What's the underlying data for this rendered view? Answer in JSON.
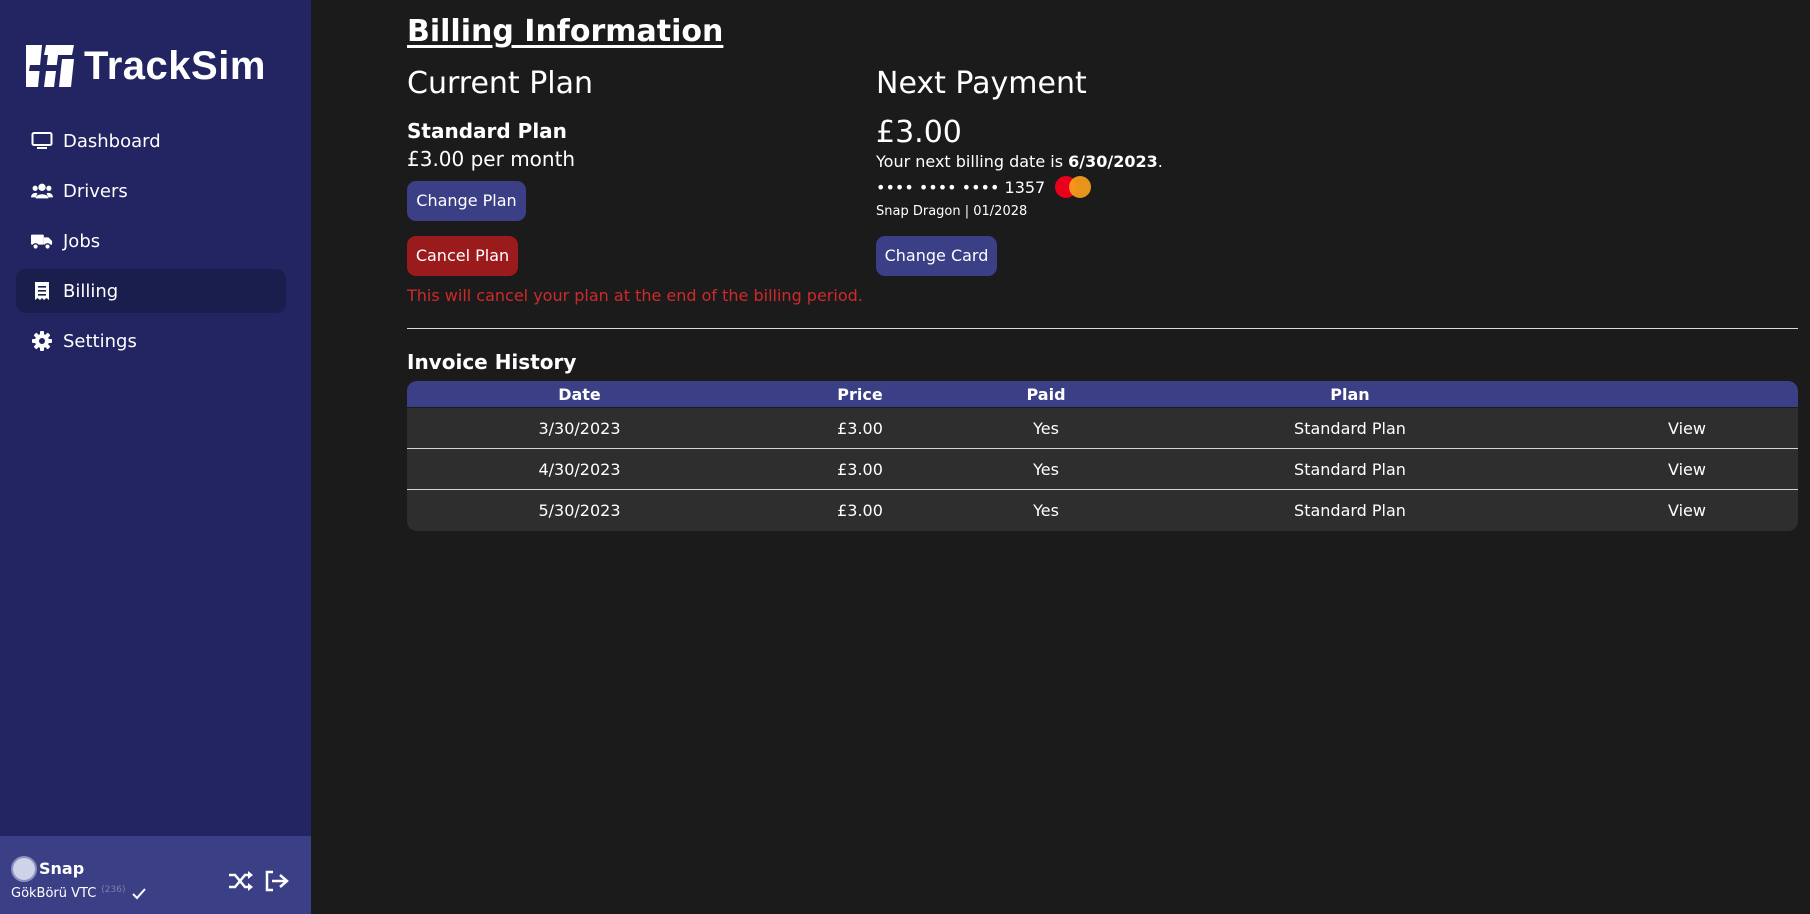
{
  "app": {
    "logo_text": "TrackSim"
  },
  "sidebar": {
    "items": [
      {
        "label": "Dashboard",
        "icon": "monitor-icon"
      },
      {
        "label": "Drivers",
        "icon": "users-icon"
      },
      {
        "label": "Jobs",
        "icon": "truck-icon"
      },
      {
        "label": "Billing",
        "icon": "receipt-icon",
        "active": true
      },
      {
        "label": "Settings",
        "icon": "gear-icon"
      }
    ],
    "user": {
      "name": "Snap",
      "company": "GökBörü VTC",
      "company_id": "(236)"
    }
  },
  "billing": {
    "title": "Billing Information",
    "current_plan": {
      "heading": "Current Plan",
      "name": "Standard Plan",
      "price": "£3.00 per month",
      "change_label": "Change Plan",
      "cancel_label": "Cancel Plan",
      "cancel_note": "This will cancel your plan at the end of the billing period."
    },
    "next_payment": {
      "heading": "Next Payment",
      "amount": "£3.00",
      "date_prefix": "Your next billing date is ",
      "date": "6/30/2023",
      "date_suffix": ".",
      "card_mask": "•••• •••• •••• 1357",
      "card_holder": "Snap Dragon | 01/2028",
      "change_card_label": "Change Card"
    }
  },
  "invoices": {
    "title": "Invoice History",
    "columns": [
      "Date",
      "Price",
      "Paid",
      "Plan",
      ""
    ],
    "rows": [
      {
        "date": "3/30/2023",
        "price": "£3.00",
        "paid": "Yes",
        "plan": "Standard Plan",
        "action": "View"
      },
      {
        "date": "4/30/2023",
        "price": "£3.00",
        "paid": "Yes",
        "plan": "Standard Plan",
        "action": "View"
      },
      {
        "date": "5/30/2023",
        "price": "£3.00",
        "paid": "Yes",
        "plan": "Standard Plan",
        "action": "View"
      }
    ]
  },
  "colors": {
    "sidebar_bg": "#222562",
    "accent": "#3b3f85",
    "danger": "#9b1a1c",
    "danger_text": "#cf2a2a",
    "background": "#1b1b1b"
  }
}
